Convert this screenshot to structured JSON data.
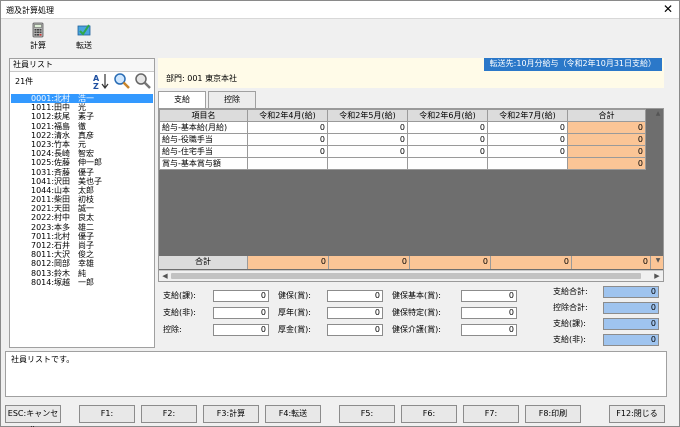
{
  "window": {
    "title": "遡及計算処理",
    "close": "✕"
  },
  "toolbar": {
    "calc_label": "計算",
    "transfer_label": "転送"
  },
  "employees": {
    "header": "社員リスト",
    "count": "21件",
    "items": [
      "0001:北村　浩一",
      "1011:田中　光",
      "1012:萩尾　素子",
      "1021:福島　徹",
      "1022:清水　真彦",
      "1023:竹本　元",
      "1024:長崎　智宏",
      "1025:佐藤　伸一郎",
      "1031:斉藤　優子",
      "1041:沢田　美也子",
      "1044:山本　太郎",
      "2011:柴田　初枝",
      "2021:天田　誠一",
      "2022:村中　良太",
      "2023:本多　雄二",
      "7011:北村　優子",
      "7012:石井　尚子",
      "8011:大沢　俊之",
      "8012:岡部　幸雄",
      "8013:鈴木　純",
      "8014:塚越　一郎"
    ]
  },
  "dept": {
    "transfer_to": "転送先:10月分給与（令和2年10月31日支給）",
    "dept_label": "部門:",
    "dept_value": "001 東京本社"
  },
  "tabs": [
    {
      "label": "支給"
    },
    {
      "label": "控除"
    }
  ],
  "grid": {
    "headers": [
      "項目名",
      "令和2年4月(給)",
      "令和2年5月(給)",
      "令和2年6月(給)",
      "令和2年7月(給)",
      "合計"
    ],
    "rows": [
      {
        "name": "給与-基本給(月給)",
        "v": [
          "0",
          "0",
          "0",
          "0",
          "0"
        ]
      },
      {
        "name": "給与-役職手当",
        "v": [
          "0",
          "0",
          "0",
          "0",
          "0"
        ]
      },
      {
        "name": "給与-住宅手当",
        "v": [
          "0",
          "0",
          "0",
          "0",
          "0"
        ]
      },
      {
        "name": "賞与-基本賞与額",
        "v": [
          "",
          "",
          "",
          "",
          "0"
        ]
      }
    ],
    "sum": {
      "label": "合計",
      "v": [
        "0",
        "0",
        "0",
        "0",
        "0"
      ]
    }
  },
  "fields": {
    "c1": [
      {
        "label": "支給(課):",
        "value": "0"
      },
      {
        "label": "支給(非):",
        "value": "0"
      },
      {
        "label": "控除:",
        "value": "0"
      }
    ],
    "c2": [
      {
        "label": "健保(賞):",
        "value": "0"
      },
      {
        "label": "厚年(賞):",
        "value": "0"
      },
      {
        "label": "厚金(賞):",
        "value": "0"
      }
    ],
    "c3": [
      {
        "label": "健保基本(賞):",
        "value": "0"
      },
      {
        "label": "健保特定(賞):",
        "value": "0"
      },
      {
        "label": "健保介護(賞):",
        "value": "0"
      }
    ],
    "c4": [
      {
        "label": "支給合計:",
        "value": "0"
      },
      {
        "label": "控除合計:",
        "value": "0"
      },
      {
        "label": "支給(課):",
        "value": "0"
      },
      {
        "label": "支給(非):",
        "value": "0"
      }
    ]
  },
  "status": {
    "message": "社員リストです。"
  },
  "fkeys": [
    "ESC:キャンセル",
    "F1:",
    "F2:",
    "F3:計算",
    "F4:転送",
    "F5:",
    "F6:",
    "F7:",
    "F8:印刷",
    "F12:閉じる"
  ],
  "colors": {
    "selection": "#3399ff",
    "total": "#fbc596",
    "summary_box": "#9fc4ef",
    "banner": "#2b78c9"
  }
}
